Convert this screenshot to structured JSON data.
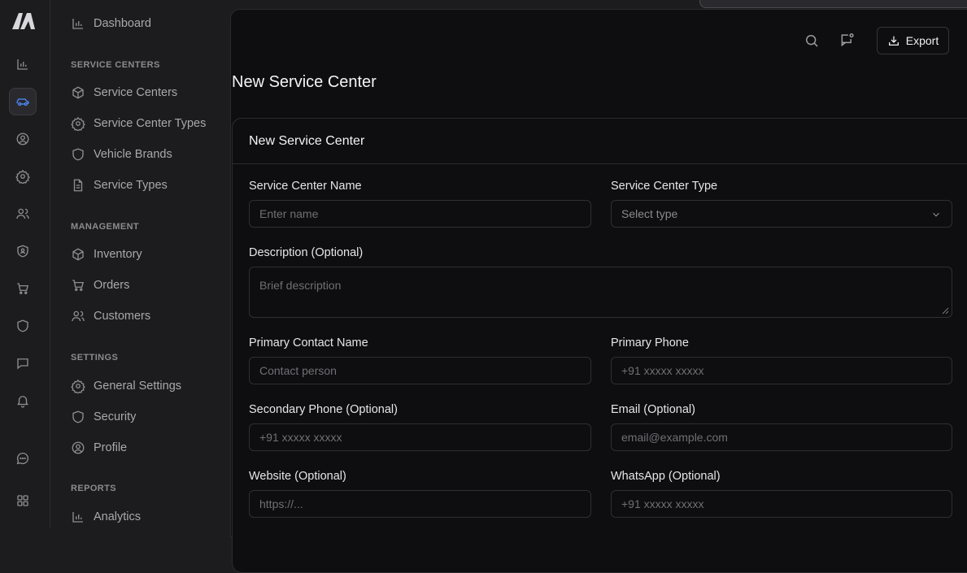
{
  "sidebar": {
    "top_item": "Dashboard",
    "sections": [
      {
        "header": "SERVICE CENTERS",
        "items": [
          "Service Centers",
          "Service Center Types",
          "Vehicle Brands",
          "Service Types"
        ]
      },
      {
        "header": "MANAGEMENT",
        "items": [
          "Inventory",
          "Orders",
          "Customers"
        ]
      },
      {
        "header": "SETTINGS",
        "items": [
          "General Settings",
          "Security",
          "Profile"
        ]
      },
      {
        "header": "REPORTS",
        "items": [
          "Analytics"
        ]
      }
    ]
  },
  "topbar": {
    "export_label": "Export"
  },
  "page": {
    "title": "New Service Center"
  },
  "card": {
    "title": "New Service Center",
    "fields": {
      "name": {
        "label": "Service Center Name",
        "placeholder": "Enter name"
      },
      "type": {
        "label": "Service Center Type",
        "placeholder": "Select type"
      },
      "description": {
        "label": "Description (Optional)",
        "placeholder": "Brief description"
      },
      "contact_name": {
        "label": "Primary Contact Name",
        "placeholder": "Contact person"
      },
      "primary_phone": {
        "label": "Primary Phone",
        "placeholder": "+91 xxxxx xxxxx"
      },
      "secondary_phone": {
        "label": "Secondary Phone (Optional)",
        "placeholder": "+91 xxxxx xxxxx"
      },
      "email": {
        "label": "Email (Optional)",
        "placeholder": "email@example.com"
      },
      "website": {
        "label": "Website (Optional)",
        "placeholder": "https://..."
      },
      "whatsapp": {
        "label": "WhatsApp (Optional)",
        "placeholder": "+91 xxxxx xxxxx"
      }
    }
  },
  "colors": {
    "accent": "#4d8dff",
    "background": "#0e0e10",
    "sidebar": "#1c1c1e"
  }
}
